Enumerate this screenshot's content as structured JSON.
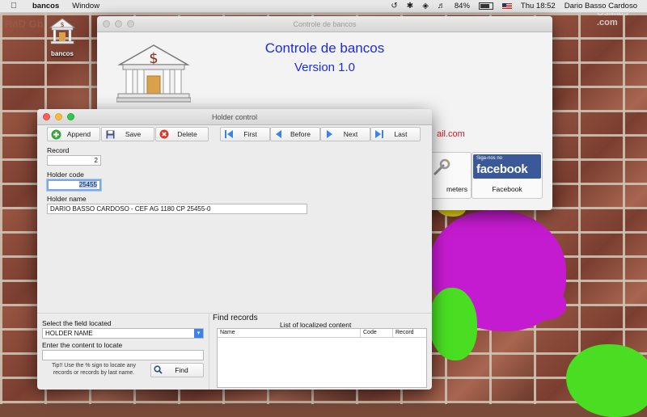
{
  "menubar": {
    "app_name": "bancos",
    "menus": [
      "Window"
    ],
    "battery": "84%",
    "clock": "Thu 18:52",
    "user": "Dario Basso Cardoso"
  },
  "desktop": {
    "icon_label": "bancos",
    "watermark_left": "RaD Gb",
    "watermark_right": "OsMais .com"
  },
  "main_window": {
    "title": "Controle de bancos",
    "app_title": "Controle de bancos",
    "version": "Version 1.0",
    "email_fragment": "ail.com",
    "tiles": [
      {
        "label": "meters"
      },
      {
        "label": "Facebook",
        "logo_small": "Siga-nos no",
        "logo_big": "facebook"
      }
    ]
  },
  "holder_window": {
    "title": "Holder control",
    "toolbar": {
      "append": "Append",
      "save": "Save",
      "delete": "Delete",
      "first": "First",
      "before": "Before",
      "next": "Next",
      "last": "Last"
    },
    "record_label": "Record",
    "record_value": "2",
    "holder_code_label": "Holder code",
    "holder_code_value": "25455",
    "holder_name_label": "Holder name",
    "holder_name_value": "DARIO BASSO CARDOSO - CEF AG 1180 CP 25455-0",
    "search": {
      "field_label": "Select the field located",
      "field_value": "HOLDER NAME",
      "content_label": "Enter the content to locate",
      "content_value": "",
      "tip": "Tip!! Use the % sign to locate any records or records by last name.",
      "find_button": "Find"
    },
    "results": {
      "title": "Find records",
      "list_title": "List of localized content",
      "columns": [
        "Name",
        "Code",
        "Record"
      ]
    }
  },
  "colors": {
    "accent_blue": "#1d2be3",
    "email_red": "#e0141a",
    "facebook_blue": "#3b5998"
  }
}
